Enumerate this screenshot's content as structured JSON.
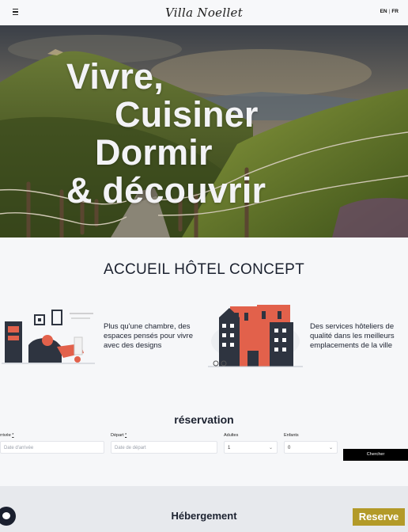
{
  "header": {
    "logo": "Villa Noellet",
    "lang_en": "EN",
    "lang_sep": "|",
    "lang_fr": "FR",
    "menu_icon": "hamburger-menu-icon"
  },
  "hero": {
    "lines": [
      "Vivre,",
      "Cuisiner",
      "Dormir",
      "& découvrir"
    ]
  },
  "concept": {
    "title": "ACCUEIL HÔTEL CONCEPT",
    "feature1": {
      "illustration": "designer-room-illustration",
      "line1": "Plus qu'une chambre, des",
      "line2": "espaces pensés pour vivre",
      "line3": "avec des designs"
    },
    "feature2": {
      "illustration": "city-buildings-illustration",
      "line1": "Des services hôteliers de",
      "line2": "qualité dans les meilleurs",
      "line3": "emplacements de la ville"
    }
  },
  "reservation": {
    "title": "réservation",
    "arrival_label": "Arrivée",
    "arrival_label_visible": "rrivée",
    "required_mark": "*",
    "arrival_placeholder": "Date d'arrivée",
    "departure_label": "Départ",
    "departure_placeholder": "Date de départ",
    "adults_label": "Adultes",
    "adults_value": "1",
    "children_label": "Enfants",
    "children_value": "0",
    "search_button": "Chercher"
  },
  "bottom": {
    "title": "Hébergement",
    "reserve_button": "Reserve",
    "reserve_color": "#b39a28",
    "chat_icon": "chat-bubble-icon"
  }
}
